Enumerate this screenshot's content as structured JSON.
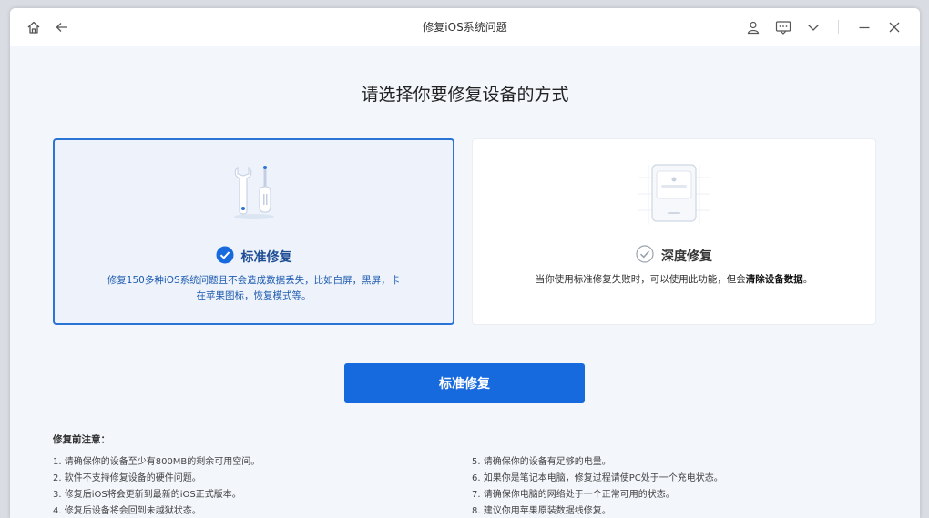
{
  "window": {
    "title": "修复iOS系统问题",
    "titlebar_icons": [
      "home-icon",
      "back-arrow-icon",
      "user-icon",
      "feedback-icon",
      "chevron-down-icon",
      "minimize-icon",
      "close-icon"
    ]
  },
  "main": {
    "heading": "请选择你要修复设备的方式",
    "cards": [
      {
        "title": "标准修复",
        "selected": true,
        "desc_line1": "修复150多种iOS系统问题且不会造成数据丢失，比如白屏，黑屏，卡",
        "desc_line2": "在苹果图标，恢复模式等。"
      },
      {
        "title": "深度修复",
        "selected": false,
        "desc_prefix": "当你使用标准修复失败时，可以使用此功能，但会",
        "desc_bold": "清除设备数据",
        "desc_suffix": "。"
      }
    ],
    "primary_button": "标准修复"
  },
  "notes": {
    "title": "修复前注意：",
    "left": [
      "1.  请确保你的设备至少有800MB的剩余可用空间。",
      "2.  软件不支持修复设备的硬件问题。",
      "3.  修复后iOS将会更新到最新的iOS正式版本。",
      "4.  修复后设备将会回到未越狱状态。"
    ],
    "right": [
      "5.  请确保你的设备有足够的电量。",
      "6.  如果你是笔记本电脑，修复过程请使PC处于一个充电状态。",
      "7.  请确保你电脑的网络处于一个正常可用的状态。",
      "8.  建议你用苹果原装数据线修复。"
    ]
  },
  "colors": {
    "accent": "#1769de",
    "selected_border": "#2a74d6",
    "selected_bg": "#eef3fb"
  }
}
